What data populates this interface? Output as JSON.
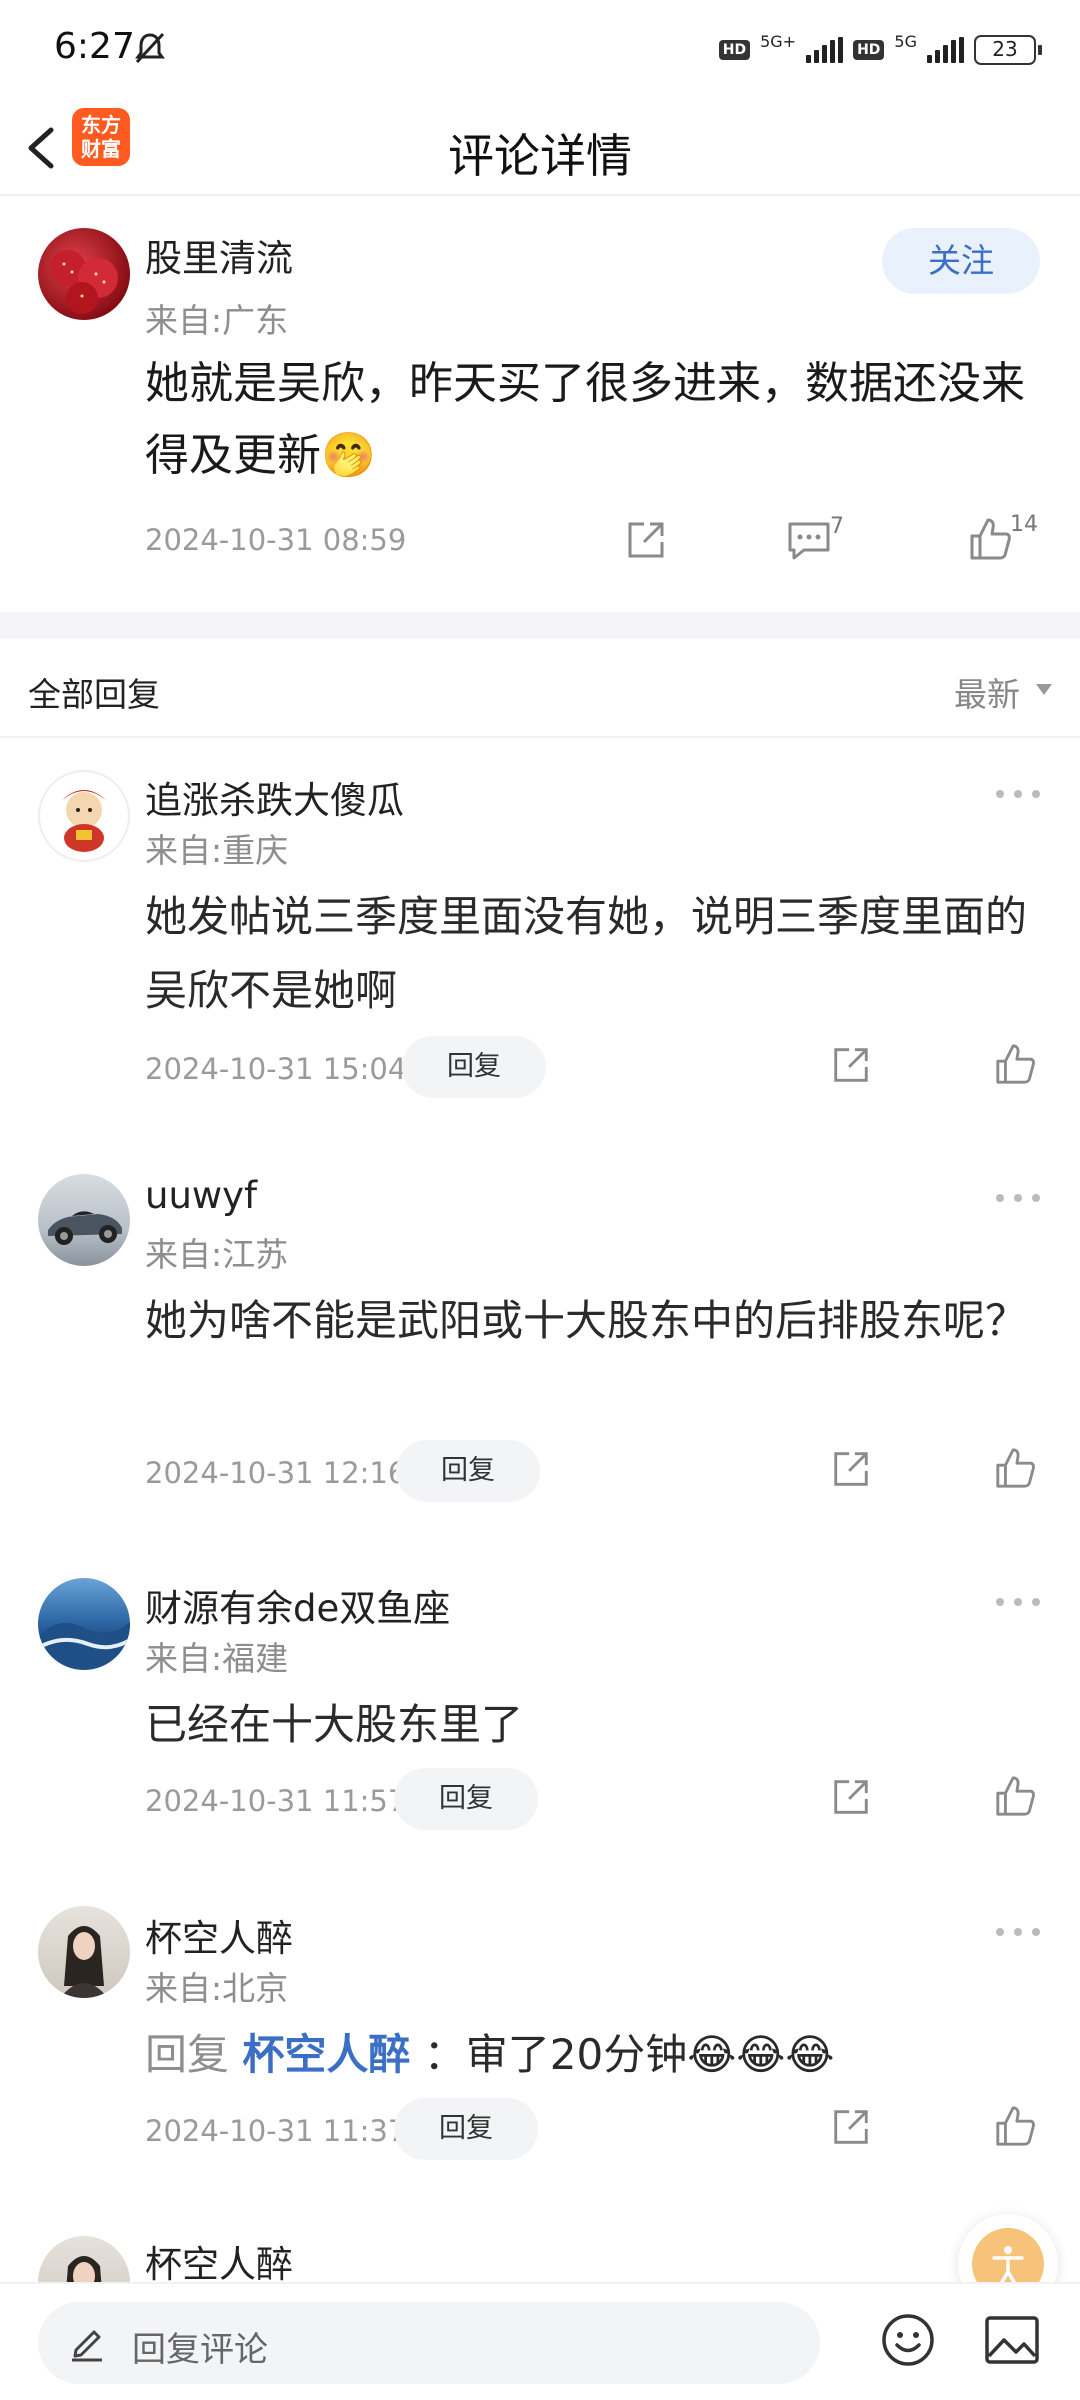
{
  "status_bar": {
    "time": "6:27",
    "network_1": "5G+",
    "network_2": "5G",
    "hd": "HD",
    "battery": "23"
  },
  "header": {
    "title": "评论详情",
    "logo_line1": "东方",
    "logo_line2": "财富"
  },
  "main_comment": {
    "username": "股里清流",
    "location": "来自:广东",
    "follow_label": "关注",
    "text": "她就是吴欣，昨天买了很多进来，数据还没来得及更新🤭",
    "date": "2024-10-31 08:59",
    "comment_count": "7",
    "like_count": "14"
  },
  "replies_header": {
    "title": "全部回复",
    "sort": "最新"
  },
  "replies": [
    {
      "username": "追涨杀跌大傻瓜",
      "location": "来自:重庆",
      "text": "她发帖说三季度里面没有她，说明三季度里面的吴欣不是她啊",
      "date": "2024-10-31 15:04",
      "reply_label": "回复"
    },
    {
      "username": "uuwyf",
      "location": "来自:江苏",
      "text": "她为啥不能是武阳或十大股东中的后排股东呢？",
      "date": "2024-10-31 12:16",
      "reply_label": "回复"
    },
    {
      "username": "财源有余de双鱼座",
      "location": "来自:福建",
      "text": "已经在十大股东里了",
      "date": "2024-10-31 11:57",
      "reply_label": "回复"
    },
    {
      "username": "杯空人醉",
      "location": "来自:北京",
      "reply_prefix": "回复",
      "reply_target": "杯空人醉",
      "text": "：审了20分钟😂😂😂",
      "date": "2024-10-31 11:37",
      "reply_label": "回复"
    },
    {
      "username": "杯空人醉"
    }
  ],
  "bottom_bar": {
    "placeholder": "回复评论"
  },
  "colors": {
    "accent_blue": "#3b6fc5",
    "brand_orange": "#ff5a1f",
    "muted_gray": "#9a9a9a"
  }
}
